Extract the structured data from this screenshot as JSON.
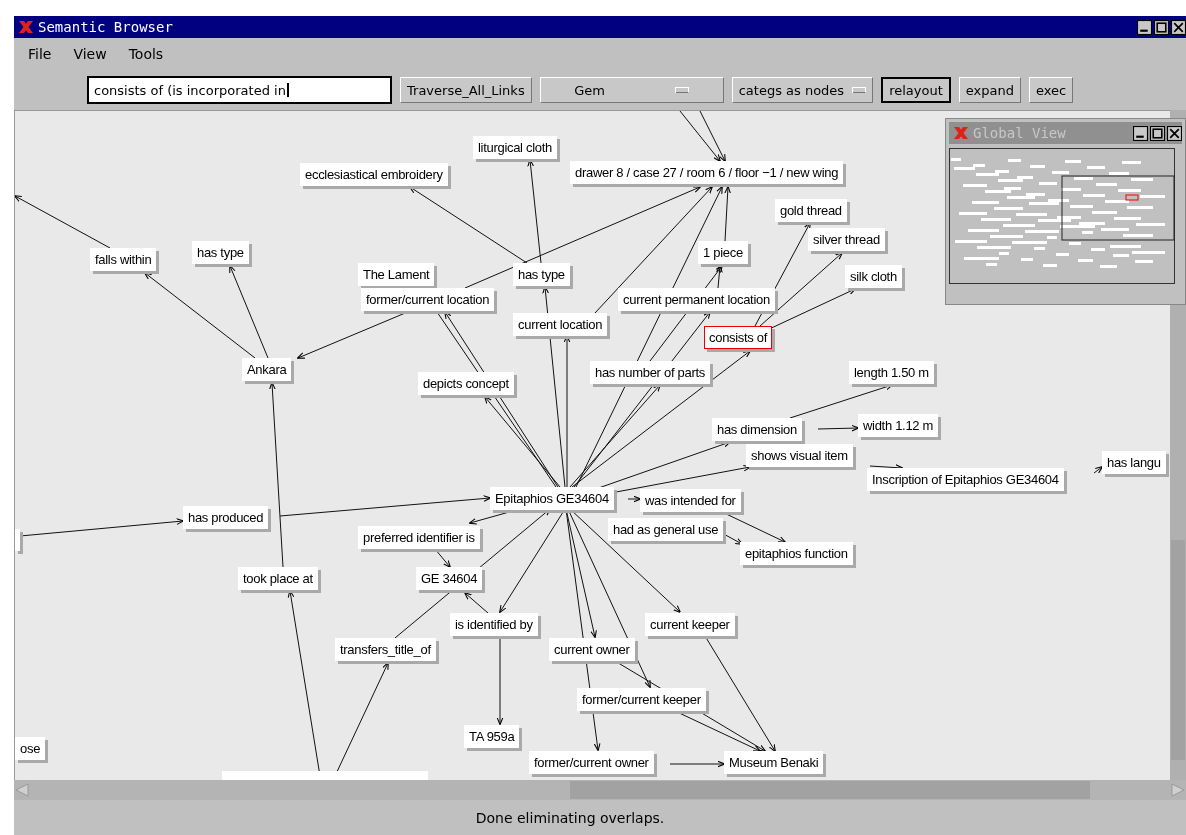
{
  "window": {
    "title": "Semantic Browser"
  },
  "menu": [
    "File",
    "View",
    "Tools"
  ],
  "toolbar": {
    "query": {
      "value": "consists of (is incorporated in"
    },
    "controls": [
      {
        "label": "Traverse_All_Links",
        "kind": "button",
        "selected": false
      },
      {
        "label": "Gem",
        "kind": "dropdown",
        "selected": false
      },
      {
        "label": "categs as nodes",
        "kind": "dropdown",
        "selected": false
      },
      {
        "label": "relayout",
        "kind": "button",
        "selected": true
      },
      {
        "label": "expand",
        "kind": "button",
        "selected": false
      },
      {
        "label": "exec",
        "kind": "button",
        "selected": false
      }
    ]
  },
  "graph": {
    "nodes": [
      {
        "label": "liturgical cloth",
        "selected": false
      },
      {
        "label": "ecclesiastical embroidery",
        "selected": false
      },
      {
        "label": "drawer 8 / case 27 / room 6 / floor −1 / new wing",
        "selected": false
      },
      {
        "label": "gold thread",
        "selected": false
      },
      {
        "label": "silver thread",
        "selected": false
      },
      {
        "label": "1 piece",
        "selected": false
      },
      {
        "label": "silk cloth",
        "selected": false
      },
      {
        "label": "falls within",
        "selected": false
      },
      {
        "label": "has type",
        "selected": false
      },
      {
        "label": "The Lament",
        "selected": false
      },
      {
        "label": "has type",
        "selected": false
      },
      {
        "label": "former/current location",
        "selected": false
      },
      {
        "label": "current permanent location",
        "selected": false
      },
      {
        "label": "current location",
        "selected": false
      },
      {
        "label": "consists of",
        "selected": true
      },
      {
        "label": "Ankara",
        "selected": false
      },
      {
        "label": "has number of parts",
        "selected": false
      },
      {
        "label": "depicts concept",
        "selected": false
      },
      {
        "label": "length 1.50 m",
        "selected": false
      },
      {
        "label": "has dimension",
        "selected": false
      },
      {
        "label": "width 1.12 m",
        "selected": false
      },
      {
        "label": "shows visual item",
        "selected": false
      },
      {
        "label": "Inscription of Epitaphios GE34604",
        "selected": false
      },
      {
        "label": "has langu",
        "selected": false
      },
      {
        "label": "Epitaphios GE34604",
        "selected": false
      },
      {
        "label": "was intended for",
        "selected": false
      },
      {
        "label": "has produced",
        "selected": false
      },
      {
        "label": "had as general use",
        "selected": false
      },
      {
        "label": "preferred identifier is",
        "selected": false
      },
      {
        "label": "epitaphios function",
        "selected": false
      },
      {
        "label": "took place at",
        "selected": false
      },
      {
        "label": "GE 34604",
        "selected": false
      },
      {
        "label": "is identified by",
        "selected": false
      },
      {
        "label": "current keeper",
        "selected": false
      },
      {
        "label": "transfers_title_of",
        "selected": false
      },
      {
        "label": "current owner",
        "selected": false
      },
      {
        "label": "former/current keeper",
        "selected": false
      },
      {
        "label": "TA 959a",
        "selected": false
      },
      {
        "label": "ose",
        "selected": false
      },
      {
        "label": "former/current owner",
        "selected": false
      },
      {
        "label": "Museum Benaki",
        "selected": false
      }
    ]
  },
  "global_view": {
    "title": "Global View"
  },
  "status_bar": "Done eliminating overlaps."
}
